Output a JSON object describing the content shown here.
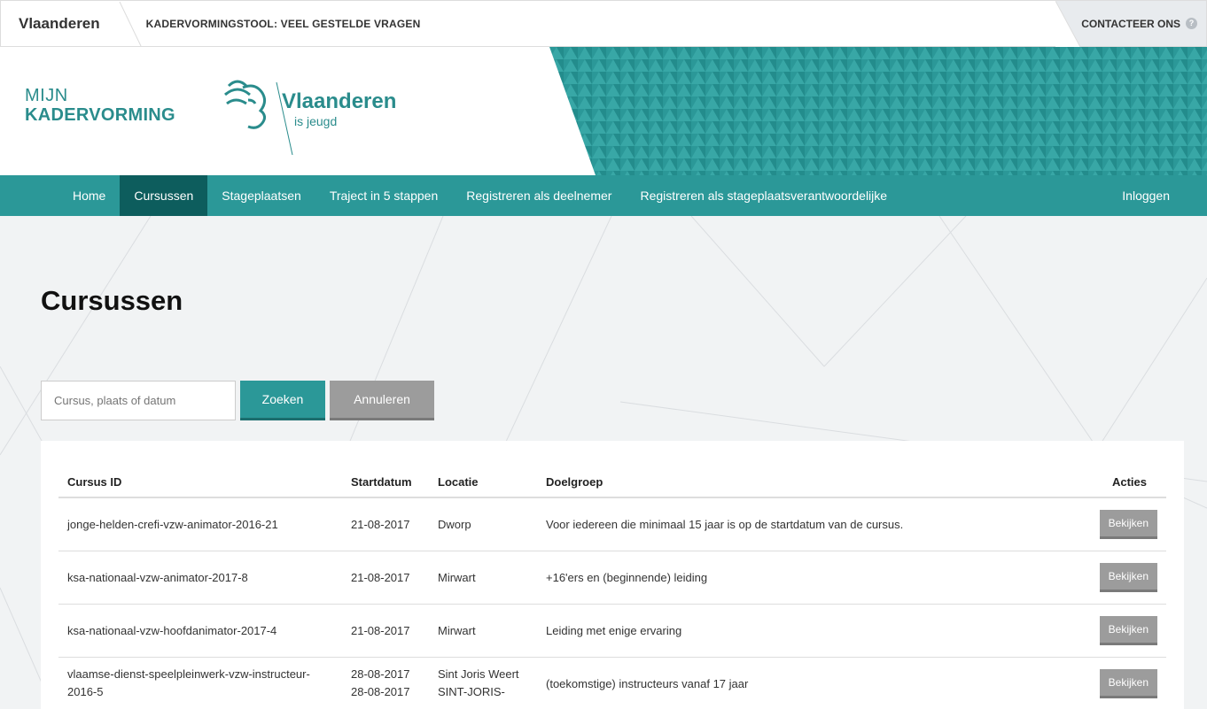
{
  "topbar": {
    "brand": "Vlaanderen",
    "tool_title": "KADERVORMINGSTOOL: VEEL GESTELDE VRAGEN",
    "contact": "CONTACTEER ONS",
    "help": "?"
  },
  "header": {
    "logo_line1": "MIJN",
    "logo_line2": "KADERVORMING",
    "vlaanderen": "Vlaanderen",
    "tagline": "is jeugd"
  },
  "nav": {
    "items": [
      "Home",
      "Cursussen",
      "Stageplaatsen",
      "Traject in 5 stappen",
      "Registreren als deelnemer",
      "Registreren als stageplaatsverantwoordelijke"
    ],
    "active": "Cursussen",
    "login": "Inloggen"
  },
  "page": {
    "title": "Cursussen"
  },
  "search": {
    "placeholder": "Cursus, plaats of datum",
    "submit": "Zoeken",
    "cancel": "Annuleren"
  },
  "table": {
    "headers": [
      "Cursus ID",
      "Startdatum",
      "Locatie",
      "Doelgroep",
      "Acties"
    ],
    "action_label": "Bekijken",
    "rows": [
      {
        "id": "jonge-helden-crefi-vzw-animator-2016-21",
        "date": "21-08-2017",
        "date2": "",
        "location": "Dworp",
        "location2": "",
        "target": "Voor iedereen die minimaal 15 jaar is op de startdatum van de cursus."
      },
      {
        "id": "ksa-nationaal-vzw-animator-2017-8",
        "date": "21-08-2017",
        "date2": "",
        "location": "Mirwart",
        "location2": "",
        "target": "+16'ers en (beginnende) leiding"
      },
      {
        "id": "ksa-nationaal-vzw-hoofdanimator-2017-4",
        "date": "21-08-2017",
        "date2": "",
        "location": "Mirwart",
        "location2": "",
        "target": "Leiding met enige ervaring"
      },
      {
        "id": "vlaamse-dienst-speelpleinwerk-vzw-instructeur-2016-5",
        "date": "28-08-2017",
        "date2": "28-08-2017",
        "location": "Sint Joris Weert",
        "location2": "SINT-JORIS-",
        "target": "(toekomstige) instructeurs vanaf 17 jaar"
      }
    ]
  },
  "colors": {
    "teal": "#2b9898",
    "teal_dark": "#0d5d5d",
    "gray_button": "#9c9c9c"
  }
}
